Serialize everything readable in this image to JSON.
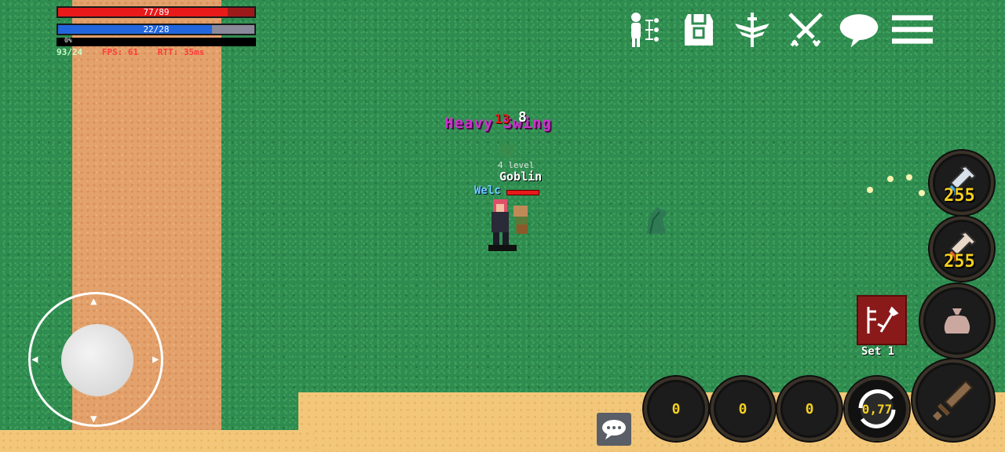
{
  "hud": {
    "hp": {
      "current": 77,
      "max": 89,
      "label": "77/89"
    },
    "mp": {
      "current": 22,
      "max": 28,
      "label": "22/28"
    },
    "xp": {
      "percent": 0,
      "label": "0%"
    },
    "counter": "93/24",
    "fps": "FPS: 61",
    "rtt": "RTT: 35ms"
  },
  "top_menu": [
    {
      "name": "skill-tree-icon"
    },
    {
      "name": "equipment-icon"
    },
    {
      "name": "guild-icon"
    },
    {
      "name": "pvp-icon"
    },
    {
      "name": "chat-bubble-icon"
    },
    {
      "name": "hamburger-menu-icon"
    }
  ],
  "combat": {
    "skill_text": "Heavy Swing",
    "damage_red": "13",
    "damage_white": "8",
    "target_level": "4 level",
    "target_name": "Goblin",
    "player_name": "Welc"
  },
  "potions": [
    {
      "type": "mana",
      "count": "255",
      "color": "#4aa8e8"
    },
    {
      "type": "health",
      "count": "255",
      "color": "#e86a2a"
    }
  ],
  "weapon_set": {
    "label": "Set 1"
  },
  "skill_slots": [
    {
      "value": "0"
    },
    {
      "value": "0"
    },
    {
      "value": "0"
    },
    {
      "value": "0,77"
    }
  ],
  "colors": {
    "hp": "#e81a1a",
    "mp": "#2266dd",
    "skill_text": "#cc33cc",
    "counter_text": "#f5d020"
  }
}
